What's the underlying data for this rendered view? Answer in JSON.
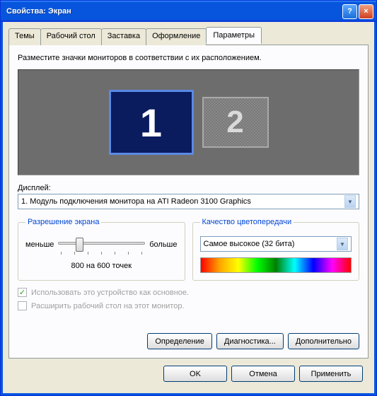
{
  "window": {
    "title": "Свойства: Экран"
  },
  "tabs": {
    "themes": "Темы",
    "desktop": "Рабочий стол",
    "screensaver": "Заставка",
    "appearance": "Оформление",
    "settings": "Параметры"
  },
  "instruction": "Разместите значки мониторов в соответствии с их расположением.",
  "monitors": {
    "primary": "1",
    "secondary": "2"
  },
  "display": {
    "label": "Дисплей:",
    "value": "1. Модуль подключения монитора на ATI Radeon 3100 Graphics"
  },
  "resolution": {
    "legend": "Разрешение экрана",
    "less": "меньше",
    "more": "больше",
    "value": "800 на 600 точек"
  },
  "color": {
    "legend": "Качество цветопередачи",
    "value": "Самое высокое (32 бита)"
  },
  "checkboxes": {
    "primary_device": "Использовать это устройство как основное.",
    "extend": "Расширить рабочий стол на этот монитор."
  },
  "buttons": {
    "identify": "Определение",
    "troubleshoot": "Диагностика...",
    "advanced": "Дополнительно",
    "ok": "OK",
    "cancel": "Отмена",
    "apply": "Применить"
  }
}
